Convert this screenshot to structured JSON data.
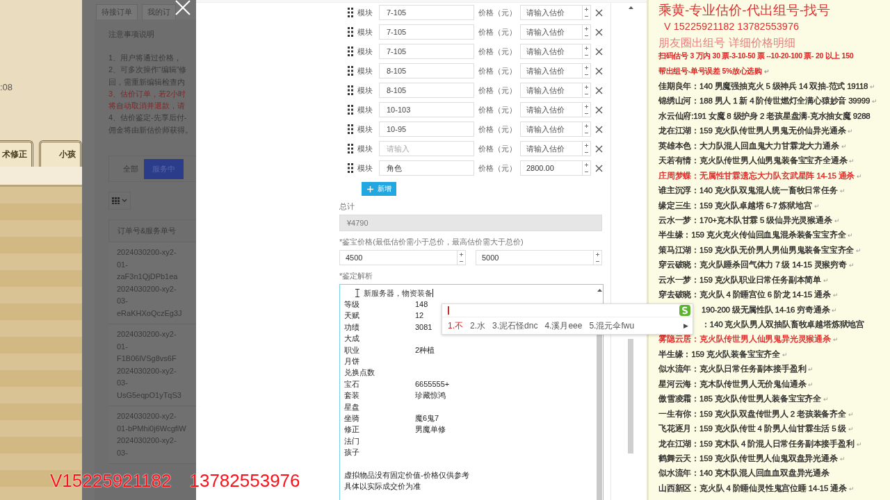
{
  "game": {
    "clock": ":08",
    "tabs": [
      {
        "label": "术修正"
      },
      {
        "label": "小孩"
      }
    ]
  },
  "order_page": {
    "tabs": [
      {
        "label": "待接订单"
      },
      {
        "label": "我的订"
      }
    ],
    "notes_title": "注意事项说明",
    "notes": [
      {
        "text": "1、用户将通过价格，",
        "kind": "normal"
      },
      {
        "text": "2、可多次操作“编辑”修",
        "kind": "normal"
      },
      {
        "text": "回，需重新编辑检查内",
        "kind": "normal"
      },
      {
        "text": "3、估价订单，若2小时",
        "kind": "warning"
      },
      {
        "text": "将自动取消并退款，请",
        "kind": "warning"
      },
      {
        "text": "4、估价鉴定-先享后付-",
        "kind": "normal"
      },
      {
        "text": "佣金将由新估价师获得。",
        "kind": "normal"
      }
    ],
    "filters": [
      {
        "label": "全部",
        "selected": false
      },
      {
        "label": "服务中",
        "selected": true
      }
    ],
    "table": {
      "columns": [
        "订单号&服务单号"
      ],
      "rows": [
        [
          "2024030200-xy2-01-zaF3n1QjDPb1ea",
          "2024030200-xy2-03-eRaKHXoQczEg3J"
        ],
        [
          "2024030200-xy2-01-F1B06lVSg8vs6F",
          "2024030200-xy2-03-UsG5eqpO1yTqS3"
        ],
        [
          "2024030200-xy2-01-bPMhi0j6WcgfiW",
          "2024030200-xy2-03-"
        ]
      ]
    }
  },
  "dialog": {
    "modules": [
      {
        "label": "模块",
        "name": "7-105",
        "price_label": "价格（元）",
        "price_placeholder": "请输入估价"
      },
      {
        "label": "模块",
        "name": "7-105",
        "price_label": "价格（元）",
        "price_placeholder": "请输入估价"
      },
      {
        "label": "模块",
        "name": "7-105",
        "price_label": "价格（元）",
        "price_placeholder": "请输入估价"
      },
      {
        "label": "模块",
        "name": "8-105",
        "price_label": "价格（元）",
        "price_placeholder": "请输入估价"
      },
      {
        "label": "模块",
        "name": "8-105",
        "price_label": "价格（元）",
        "price_placeholder": "请输入估价"
      },
      {
        "label": "模块",
        "name": "10-103",
        "price_label": "价格（元）",
        "price_placeholder": "请输入估价"
      },
      {
        "label": "模块",
        "name": "10-95",
        "price_label": "价格（元）",
        "price_placeholder": "请输入估价"
      },
      {
        "label": "模块",
        "name_placeholder": "请输入",
        "price_label": "价格（元）",
        "price_placeholder": "请输入估价"
      },
      {
        "label": "模块",
        "name": "角色",
        "price_label": "价格（元）",
        "price": "2800.00"
      }
    ],
    "add_button": "新增",
    "total_label": "总计",
    "total_value": "¥4790",
    "price_range_label": "*鉴宝价格(最低估价需小于总价，最高估价需大于总价)",
    "min_price": "4500",
    "max_price": "5000",
    "analysis_label": "*鉴定解析",
    "analysis_first_line": "新服务器，物资装备",
    "analysis_rows": [
      {
        "key": "等级",
        "value": "148"
      },
      {
        "key": "天赋",
        "value": "12"
      },
      {
        "key": "功绩",
        "value": "3081"
      },
      {
        "key": "大成"
      },
      {
        "key": "职业",
        "value": "2种植"
      },
      {
        "key": "月饼"
      },
      {
        "key": "兑换点数"
      },
      {
        "key": "宝石",
        "value": "6655555+"
      },
      {
        "key": "套装",
        "value": "珍藏惊鸿"
      },
      {
        "key": "星盘"
      },
      {
        "key": "坐骑",
        "value": "魔6鬼7"
      },
      {
        "key": "修正",
        "value": "男魔单修"
      },
      {
        "key": "法门"
      },
      {
        "key": "孩子"
      }
    ],
    "analysis_footer": [
      "虚拟物品没有固定价值-价格仅供参考",
      "具体以实际成交价为准"
    ]
  },
  "ime": {
    "candidates": [
      {
        "text": "1.不",
        "selected": true
      },
      {
        "text": "2.水",
        "selected": false
      },
      {
        "text": "3.泥石怪dnc",
        "selected": false
      },
      {
        "text": "4.溪月eee",
        "selected": false
      },
      {
        "text": "5.混元伞fwu",
        "selected": false
      }
    ],
    "next": "▶"
  },
  "notes_panel": {
    "header": [
      {
        "text": "乘黄-专业估价-代出组号-找号",
        "kind": "title"
      },
      {
        "text": "V 15225921182    13782553976",
        "kind": "contact"
      },
      {
        "text": "朋友圈出组号    详细价格明细",
        "kind": "subtitle"
      },
      {
        "text": "扫码估号 3 万内 30 票-3-10-50 票 --10-20-100 票- 20 以上 150",
        "kind": "price"
      },
      {
        "text": "帮出组号-单号误差 5%放心选购",
        "kind": "notice",
        "mark": "↵"
      }
    ],
    "lines": [
      {
        "text": "佳期良年：140 男魔强抽克火 5 级神兵 14 双抽-范式 19118",
        "kind": "line",
        "color": "#222222",
        "mark": "↵"
      },
      {
        "text": "锦绣山河：188 男人 1 新 4 阶传世燃灯全满心猿妙音 39999",
        "kind": "line",
        "color": "#222222",
        "mark": "↵"
      },
      {
        "text": "水云仙府:191 女魔 8 级护身 2 老孩星盘满-克水抽女魔 9288",
        "kind": "line",
        "color": "#222222"
      },
      {
        "text": "龙在江湖：159 克火队传世男人男鬼无价仙异光通杀",
        "kind": "line",
        "color": "#222222",
        "mark": "↵"
      },
      {
        "text": "英雄本色：大力队混人回血鬼大力甘霖龙大力通杀",
        "kind": "line",
        "color": "#222222",
        "mark": "↵"
      },
      {
        "text": "天若有情：克火队传世男人仙男鬼装备宝宝齐全通杀",
        "kind": "line",
        "color": "#222222",
        "mark": "↵"
      },
      {
        "text": "庄周梦蝶：无属性甘霖遗忘大力队玄武星阵 14-15 通杀",
        "kind": "line",
        "color": "#e02020",
        "mark": "↵"
      },
      {
        "text": "谁主沉浮：140 克火队双鬼混人统一畜牧日常任务",
        "kind": "line",
        "color": "#222222",
        "mark": "↵"
      },
      {
        "text": "缘定三生：159 克火队卓越塔 6-7 炼狱地宫",
        "kind": "line",
        "color": "#222222",
        "mark": "↵"
      },
      {
        "text": "云水一梦：170+克木队甘霖 5 级仙异光灵猴通杀",
        "kind": "line",
        "color": "#222222",
        "mark": "↵"
      },
      {
        "text": "半生缘：159 克火克火传仙回血鬼混杀装备宝宝齐全",
        "kind": "line",
        "color": "#222222",
        "mark": "↵"
      },
      {
        "text": "策马江湖：159 克火队无价男人男仙男鬼装备宝宝齐全",
        "kind": "line",
        "color": "#222222",
        "mark": "↵"
      },
      {
        "text": "穿云破晓：克火队睡杀回气体力 7 级 14-15 灵猴穷奇",
        "kind": "line",
        "color": "#222222",
        "mark": "↵"
      },
      {
        "text": "云水一梦：159 克火队职业日常任务副本简单",
        "kind": "line",
        "color": "#222222",
        "mark": "↵"
      },
      {
        "text": "穿去破晓：克火队 4 阶睡宫位 6 阶龙 14-15 通杀",
        "kind": "line",
        "color": "#222222",
        "mark": "↵"
      },
      {
        "text": "190-200 级无属性队 14-16 穷奇通杀",
        "kind": "partial",
        "color": "#222222",
        "mark": "↵"
      },
      {
        "text": "：140 克火队男人双抽队畜牧卓越塔炼狱地宫",
        "kind": "partial",
        "color": "#222222"
      },
      {
        "text": "雾隐云居：克火队传世男人仙男鬼异光灵猴通杀",
        "kind": "line",
        "color": "#e02020",
        "mark": "↵"
      },
      {
        "text": "半生缘：159 克火队装备宝宝齐全",
        "kind": "line",
        "color": "#222222",
        "mark": "↵"
      },
      {
        "text": "似水流年：克火队日常任务副本接手盈利",
        "kind": "line",
        "color": "#222222",
        "mark": "↵"
      },
      {
        "text": "星河云海：克木队传世男人无价鬼仙通杀",
        "kind": "line",
        "color": "#222222",
        "mark": "↵"
      },
      {
        "text": "傲雪凌霜：185 克火队传世男人装备宝宝齐全",
        "kind": "line",
        "color": "#222222",
        "mark": "↵"
      },
      {
        "text": "一生有你：159 克火队双盘传世男人 2 老孩装备齐全",
        "kind": "line",
        "color": "#222222",
        "mark": "↵"
      },
      {
        "text": "飞花逐月：159 克火队传世 4 阶男人仙甘霖生活 5 级",
        "kind": "line",
        "color": "#222222",
        "mark": "↵"
      },
      {
        "text": "龙在江湖：159 克木队 4 阶混人日常任务副本接手盈利",
        "kind": "line",
        "color": "#222222",
        "mark": "↵"
      },
      {
        "text": "鹤舞云天：159 克火队传世男人仙鬼双盘异光通杀",
        "kind": "line",
        "color": "#222222",
        "mark": "↵"
      },
      {
        "text": "似水流年：140 克木队混人回血血双盘异光通杀",
        "kind": "line",
        "color": "#222222"
      },
      {
        "text": "山西新区：克火队 4 阶睡仙灵性鬼宫位睡 14-15 通杀",
        "kind": "line",
        "color": "#222222",
        "mark": "↵"
      }
    ]
  },
  "overlay_text": [
    "V15225921182",
    "13782553976"
  ]
}
